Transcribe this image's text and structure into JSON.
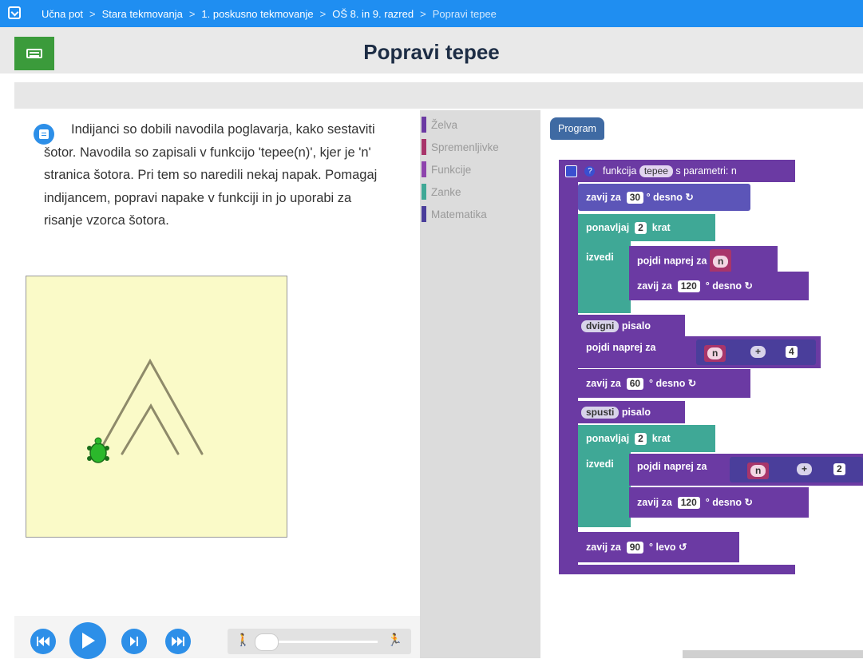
{
  "breadcrumb": {
    "items": [
      "Učna pot",
      "Stara tekmovanja",
      "1. poskusno tekmovanje",
      "OŠ 8. in 9. razred",
      "Popravi tepee"
    ],
    "separator": ">"
  },
  "page": {
    "title": "Popravi tepee"
  },
  "task": {
    "text": "Indijanci so dobili navodila poglavarja, kako sestaviti šotor. Navodila so zapisali v funkcijo 'tepee(n)', kjer je 'n' stranica šotora. Pri tem so naredili nekaj napak. Pomagaj indijancem, popravi napake v funkciji in jo uporabi za risanje vzorca šotora."
  },
  "toolbox": {
    "categories": [
      {
        "label": "Želva",
        "color": "#6b3aa3"
      },
      {
        "label": "Spremenljivke",
        "color": "#a8356a"
      },
      {
        "label": "Funkcije",
        "color": "#8e44ad"
      },
      {
        "label": "Zanke",
        "color": "#3fa896"
      },
      {
        "label": "Matematika",
        "color": "#4a3e9b"
      }
    ]
  },
  "program": {
    "label": "Program",
    "func_header": {
      "prefix": "funkcija",
      "name": "tepee",
      "suffix": "s parametri: n"
    },
    "kw": {
      "turn": "zavij za",
      "deg_right": "° desno ↻",
      "deg_left": "° levo ↺",
      "repeat": "ponavljaj",
      "times": "krat",
      "do": "izvedi",
      "forward": "pojdi naprej za",
      "pen": "pisalo",
      "pen_up": "dvigni",
      "pen_down": "spusti",
      "var_n": "n",
      "op_plus": "+"
    },
    "values": {
      "turn1": "30",
      "rep1": "2",
      "turn2": "120",
      "add1": "4",
      "turn3": "60",
      "rep2": "2",
      "add2": "2",
      "turn4": "120",
      "turn5": "90"
    }
  },
  "colors": {
    "accent": "#1f8ef1",
    "turtle": "#2bb82b"
  }
}
